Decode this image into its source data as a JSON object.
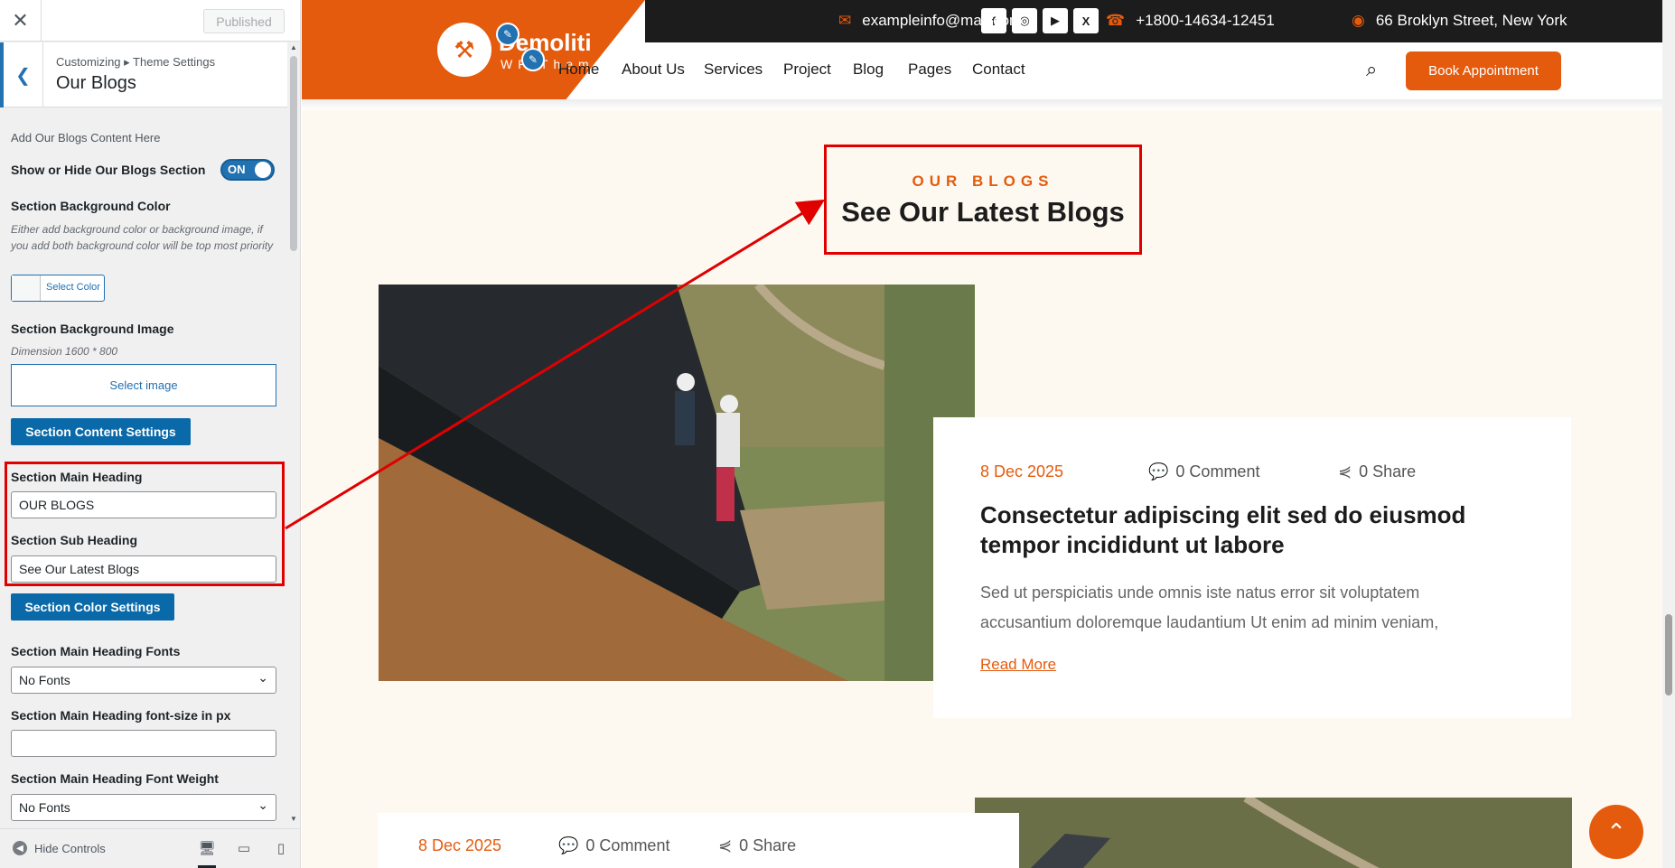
{
  "customizer": {
    "close_icon": "close-icon",
    "published_label": "Published",
    "breadcrumb": "Customizing ▸ Theme Settings",
    "title": "Our Blogs",
    "intro": "Add Our Blogs Content Here",
    "show_hide_label": "Show or Hide Our Blogs Section",
    "toggle_state": "ON",
    "bg_color_label": "Section Background Color",
    "bg_color_desc": "Either add background color or background image, if you add both background color will be top most priority",
    "select_color_label": "Select Color",
    "bg_image_label": "Section Background Image",
    "bg_image_desc": "Dimension 1600 * 800",
    "select_image_label": "Select image",
    "content_settings_label": "Section Content Settings",
    "main_heading_label": "Section Main Heading",
    "main_heading_value": "OUR BLOGS",
    "sub_heading_label": "Section Sub Heading",
    "sub_heading_value": "See Our Latest Blogs",
    "color_settings_label": "Section Color Settings",
    "heading_fonts_label": "Section Main Heading Fonts",
    "heading_fonts_value": "No Fonts",
    "heading_fontsize_label": "Section Main Heading font-size in px",
    "heading_fontsize_value": "",
    "heading_weight_label": "Section Main Heading Font Weight",
    "heading_weight_value": "No Fonts",
    "hide_controls_label": "Hide Controls",
    "highlight_color": "#e00000"
  },
  "site": {
    "logo_name": "Demoliti",
    "logo_sub": "WP Theme",
    "topbar": {
      "socials": [
        "f",
        "◎",
        "▶",
        "X"
      ],
      "email": "exampleinfo@mail.com",
      "phone": "+1800-14634-12451",
      "address": "66 Broklyn Street, New York"
    },
    "nav": [
      "Home",
      "About Us",
      "Services",
      "Project",
      "Blog",
      "Pages",
      "Contact"
    ],
    "book_button": "Book Appointment",
    "section": {
      "eyebrow": "OUR BLOGS",
      "heading": "See Our Latest Blogs"
    },
    "posts": [
      {
        "date": "8 Dec 2025",
        "comments": "0 Comment",
        "share": "0 Share",
        "title": "Consectetur adipiscing elit sed do eiusmod tempor incididunt ut labore",
        "excerpt": "Sed ut perspiciatis unde omnis iste natus error sit voluptatem accusantium doloremque laudantium Ut enim ad minim veniam,",
        "read_more": "Read More"
      },
      {
        "date": "8 Dec 2025",
        "comments": "0 Comment",
        "share": "0 Share"
      }
    ],
    "accent_color": "#e55b0d"
  }
}
